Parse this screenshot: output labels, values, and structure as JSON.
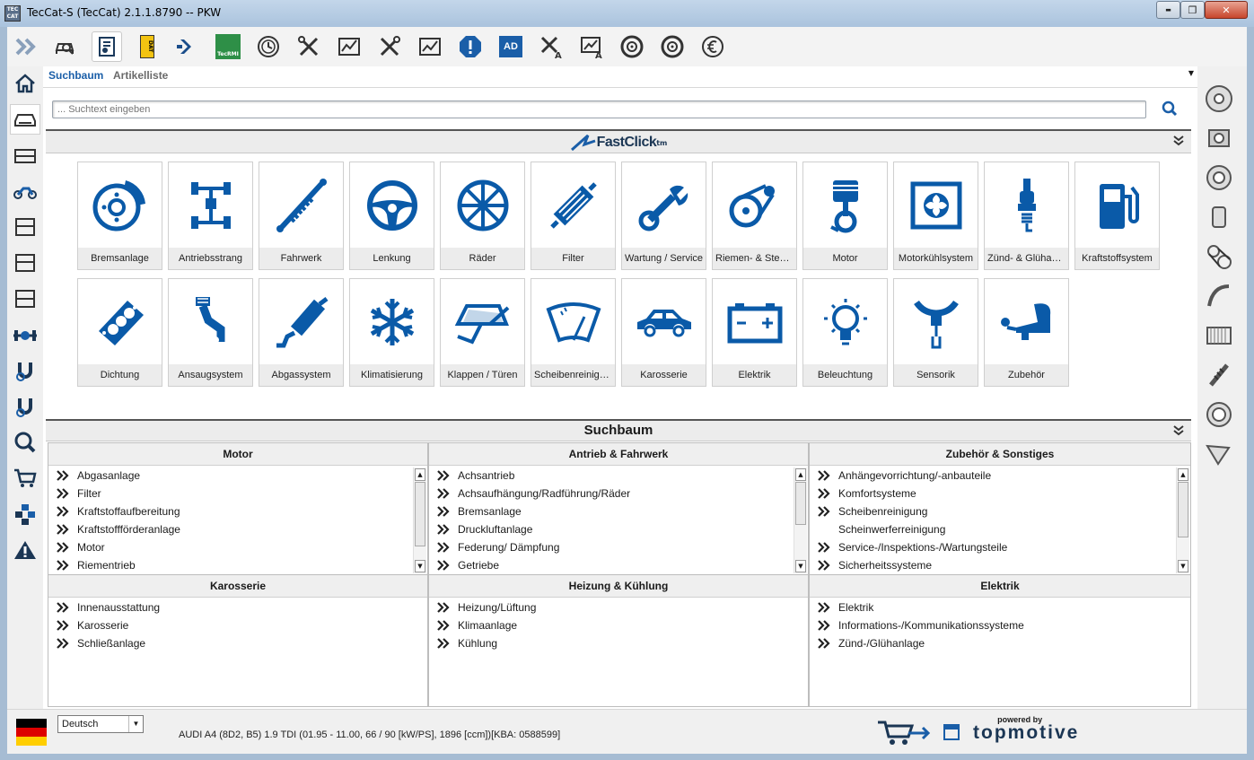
{
  "window": {
    "title": "TecCat-S (TecCat) 2.1.1.8790   --   PKW",
    "icon_text": "TEC CAT",
    "min_label": "▬",
    "max_label": "❐",
    "close_label": "✕"
  },
  "toolbar": {
    "items": [
      {
        "icon": "double-chevron-icon"
      },
      {
        "icon": "car-search-icon"
      },
      {
        "icon": "parts-catalog-icon"
      },
      {
        "icon": "dat-icon"
      },
      {
        "icon": "forward-icon"
      },
      {
        "icon": "tecrmi-icon"
      },
      {
        "icon": "maintenance-clock-icon"
      },
      {
        "icon": "tools-icon"
      },
      {
        "icon": "diagnostics-chart-icon"
      },
      {
        "icon": "tools-icon"
      },
      {
        "icon": "diagnostics-chart-icon"
      },
      {
        "icon": "alert-icon"
      },
      {
        "icon": "ad-icon"
      },
      {
        "icon": "tools-a-icon"
      },
      {
        "icon": "chart-a-icon"
      },
      {
        "icon": "tyre-icon"
      },
      {
        "icon": "tyre-icon"
      },
      {
        "icon": "euro-icon"
      }
    ],
    "tecrmi_label": "TecRMI",
    "dat_label": "DAT",
    "ad_label": "AD",
    "a_label": "A"
  },
  "tabs": {
    "search_tree": "Suchbaum",
    "article_list": "Artikelliste"
  },
  "search": {
    "placeholder": "... Suchtext eingeben"
  },
  "fastclick": {
    "title": "FastClick",
    "tm": "tm"
  },
  "tiles": [
    {
      "label": "Bremsanlage",
      "icon": "brake-disc-icon"
    },
    {
      "label": "Antriebsstrang",
      "icon": "drivetrain-icon"
    },
    {
      "label": "Fahrwerk",
      "icon": "shock-absorber-icon"
    },
    {
      "label": "Lenkung",
      "icon": "steering-wheel-icon"
    },
    {
      "label": "Räder",
      "icon": "wheel-icon"
    },
    {
      "label": "Filter",
      "icon": "filter-icon"
    },
    {
      "label": "Wartung / Service",
      "icon": "wrench-icon"
    },
    {
      "label": "Riemen- & Steuerkettentrieb",
      "icon": "belt-drive-icon"
    },
    {
      "label": "Motor",
      "icon": "piston-icon"
    },
    {
      "label": "Motorkühlsystem",
      "icon": "radiator-fan-icon"
    },
    {
      "label": "Zünd- & Glühanlage",
      "icon": "spark-plug-icon"
    },
    {
      "label": "Kraftstoffsystem",
      "icon": "fuel-pump-icon"
    },
    {
      "label": "Dichtung",
      "icon": "gasket-icon"
    },
    {
      "label": "Ansaugsystem",
      "icon": "intake-icon"
    },
    {
      "label": "Abgassystem",
      "icon": "exhaust-icon"
    },
    {
      "label": "Klimatisierung",
      "icon": "snowflake-icon"
    },
    {
      "label": "Klappen / Türen",
      "icon": "door-icon"
    },
    {
      "label": "Scheibenreinigung",
      "icon": "windshield-icon"
    },
    {
      "label": "Karosserie",
      "icon": "car-body-icon"
    },
    {
      "label": "Elektrik",
      "icon": "battery-icon"
    },
    {
      "label": "Beleuchtung",
      "icon": "light-bulb-icon"
    },
    {
      "label": "Sensorik",
      "icon": "sensor-icon"
    },
    {
      "label": "Zubehör",
      "icon": "towbar-icon"
    }
  ],
  "tree": {
    "title": "Suchbaum",
    "categories": [
      {
        "title": "Motor",
        "items": [
          "Abgasanlage",
          "Filter",
          "Kraftstoffaufbereitung",
          "Kraftstoffförderanlage",
          "Motor",
          "Riementrieb"
        ],
        "scroll": true
      },
      {
        "title": "Antrieb & Fahrwerk",
        "items": [
          "Achsantrieb",
          "Achsaufhängung/Radführung/Räder",
          "Bremsanlage",
          "Druckluftanlage",
          "Federung/ Dämpfung",
          "Getriebe"
        ],
        "scroll": true
      },
      {
        "title": "Zubehör & Sonstiges",
        "items": [
          "Anhängevorrichtung/-anbauteile",
          "Komfortsysteme",
          "Scheibenreinigung",
          "Scheinwerferreinigung",
          "Service-/Inspektions-/Wartungsteile",
          "Sicherheitssysteme"
        ],
        "no_arrow_index": 3,
        "scroll": true
      },
      {
        "title": "Karosserie",
        "items": [
          "Innenausstattung",
          "Karosserie",
          "Schließanlage"
        ]
      },
      {
        "title": "Heizung & Kühlung",
        "items": [
          "Heizung/Lüftung",
          "Klimaanlage",
          "Kühlung"
        ]
      },
      {
        "title": "Elektrik",
        "items": [
          "Elektrik",
          "Informations-/Kommunikationssysteme",
          "Zünd-/Glühanlage"
        ]
      }
    ]
  },
  "status": {
    "language": "Deutsch",
    "vehicle": "AUDI A4 (8D2, B5) 1.9 TDI (01.95 - 11.00, 66 / 90 [kW/PS], 1896 [ccm])[KBA: 0588599]",
    "powered_by": "powered by",
    "brand": "topmotive"
  },
  "colors": {
    "accent": "#1a5ea8",
    "tile_label_bg": "#ececec",
    "icon_blue": "#0a5aa8"
  }
}
